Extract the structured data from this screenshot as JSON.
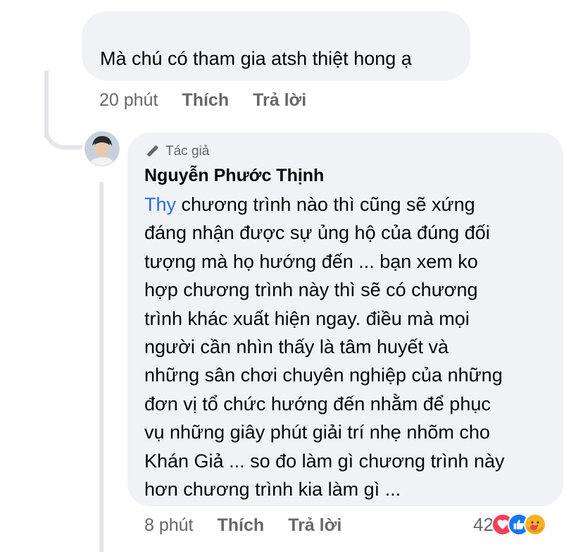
{
  "first_comment": {
    "text": "Mà chú có tham gia atsh thiệt hong ạ",
    "time": "20 phút",
    "like_label": "Thích",
    "reply_label": "Trả lời"
  },
  "reply": {
    "author_badge": "Tác giả",
    "author_name": "Nguyễn Phước Thịnh",
    "mention": "Thy",
    "lines": [
      " chương trình nào thì cũng sẽ xứng",
      "đáng nhận được sự ủng hộ của đúng đối",
      "tượng mà họ hướng đến ... bạn xem ko",
      "hợp chương trình này thì sẽ có chương",
      "trình khác xuất hiện ngay. điều mà mọi",
      "người cần nhìn thấy là tâm huyết và",
      "những sân chơi chuyên nghiệp của những",
      "đơn vị tổ chức hướng đến nhằm để phục",
      "vụ những giây phút giải trí nhẹ nhõm cho",
      "Khán Giả ... so đo làm gì chương trình này",
      "hơn chương trình kia làm gì ..."
    ],
    "time": "8 phút",
    "like_label": "Thích",
    "reply_label": "Trả lời",
    "reaction_count": "42",
    "reaction_icons": [
      "love-icon",
      "like-icon",
      "care-icon"
    ]
  },
  "colors": {
    "bubble": "#f0f2f5",
    "meta_text": "#65676b",
    "mention": "#216fdb",
    "love": "#f33e58",
    "like": "#1877f2",
    "care": "#f7b125"
  }
}
